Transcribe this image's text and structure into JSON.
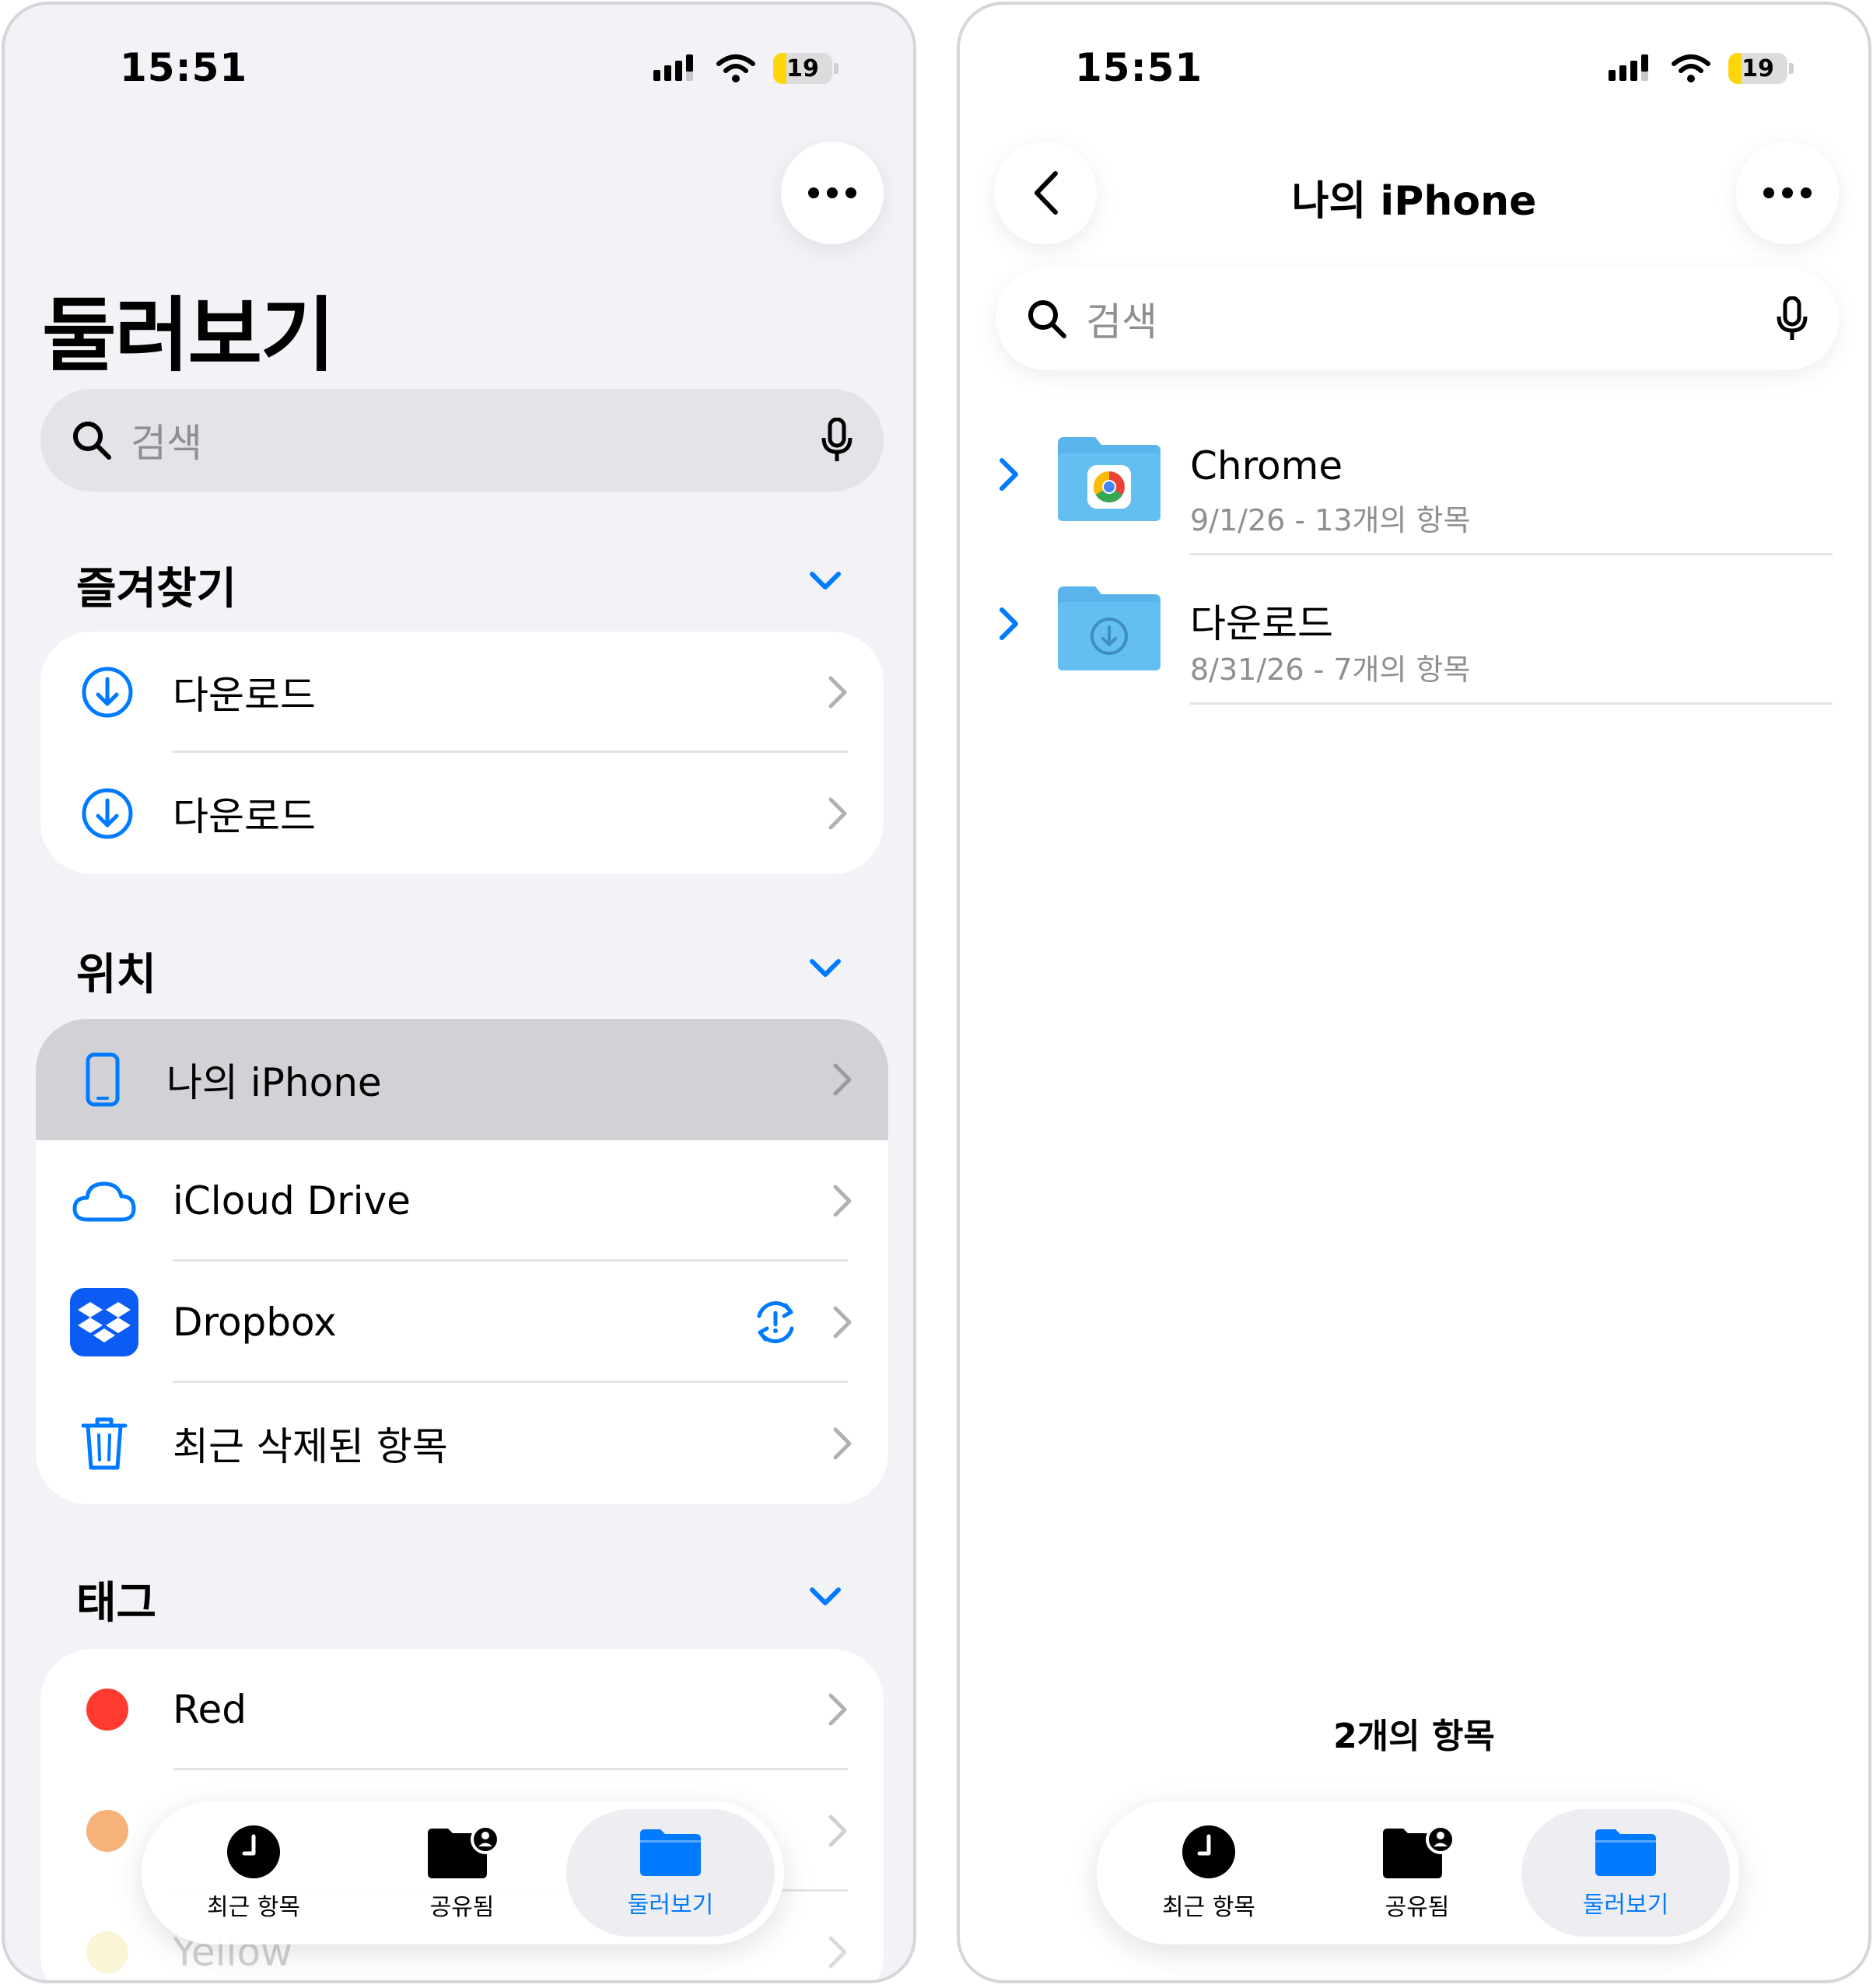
{
  "status": {
    "time": "15:51",
    "battery": "19"
  },
  "left": {
    "title": "둘러보기",
    "search_placeholder": "검색",
    "favorites": {
      "title": "즐겨찾기",
      "items": [
        {
          "label": "다운로드"
        },
        {
          "label": "다운로드"
        }
      ]
    },
    "locations": {
      "title": "위치",
      "items": [
        {
          "label": "나의 iPhone"
        },
        {
          "label": "iCloud Drive"
        },
        {
          "label": "Dropbox"
        },
        {
          "label": "최근 삭제된 항목"
        }
      ]
    },
    "tags": {
      "title": "태그",
      "items": [
        {
          "label": "Red",
          "color": "#ff3b30"
        },
        {
          "label": "",
          "color": "#f7b27a"
        },
        {
          "label": "Yellow",
          "color": "#f7e9a8"
        }
      ]
    }
  },
  "right": {
    "title": "나의 iPhone",
    "search_placeholder": "검색",
    "files": [
      {
        "name": "Chrome",
        "meta": "9/1/26 - 13개의 항목"
      },
      {
        "name": "다운로드",
        "meta": "8/31/26 - 7개의 항목"
      }
    ],
    "count": "2개의 항목"
  },
  "tabbar": {
    "tabs": [
      {
        "label": "최근 항목"
      },
      {
        "label": "공유됨"
      },
      {
        "label": "둘러보기"
      }
    ],
    "active_color": "#007aff"
  }
}
